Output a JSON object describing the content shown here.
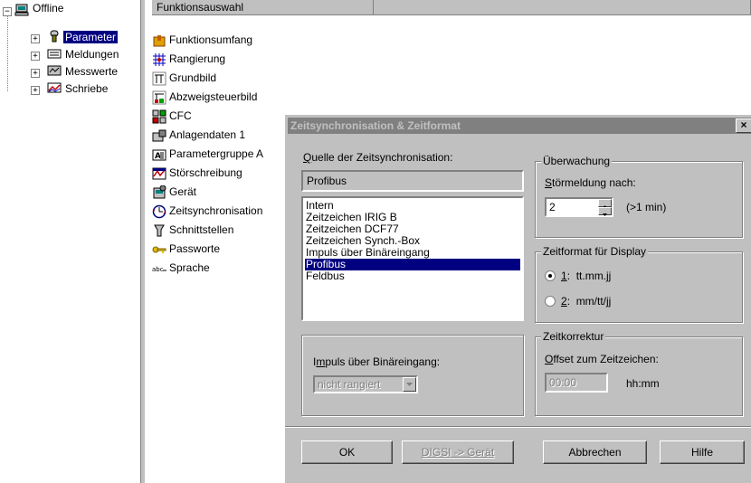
{
  "tree": {
    "root": "Offline",
    "items": [
      {
        "label": "Parameter",
        "selected": true
      },
      {
        "label": "Meldungen"
      },
      {
        "label": "Messwerte"
      },
      {
        "label": "Schriebe"
      }
    ]
  },
  "list": {
    "header": "Funktionsauswahl",
    "items": [
      "Funktionsumfang",
      "Rangierung",
      "Grundbild",
      "Abzweigsteuerbild",
      "CFC",
      "Anlagendaten 1",
      "Parametergruppe A",
      "Störschreibung",
      "Gerät",
      "Zeitsynchronisation",
      "Schnittstellen",
      "Passworte",
      "Sprache"
    ]
  },
  "dialog": {
    "title": "Zeitsynchronisation & Zeitformat",
    "close": "×",
    "source": {
      "label_prefix": "",
      "label_u": "Q",
      "label_rest": "uelle der Zeitsynchronisation:",
      "current": "Profibus",
      "options": [
        "Intern",
        "Zeitzeichen IRIG B",
        "Zeitzeichen DCF77",
        "Zeitzeichen Synch.-Box",
        "Impuls über Binäreingang",
        "Profibus",
        "Feldbus"
      ],
      "selected_index": 5
    },
    "impulse": {
      "label_pre": "I",
      "label_u": "m",
      "label_rest": "puls über Binäreingang:",
      "value": "nicht rangiert"
    },
    "monitor": {
      "legend": "Überwachung",
      "label_u": "S",
      "label_rest": "törmeldung nach:",
      "value": "2",
      "unit": "(>1 min)"
    },
    "format": {
      "legend": "Zeitformat für Display",
      "opt1_u": "1",
      "opt1_rest": ":  tt.mm.jj",
      "opt2_u": "2",
      "opt2_rest": ":  mm/tt/jj",
      "selected": 1
    },
    "correction": {
      "legend": "Zeitkorrektur",
      "label_u": "O",
      "label_rest": "ffset zum Zeitzeichen:",
      "value": "00:00",
      "unit": "hh:mm"
    },
    "buttons": {
      "ok": "OK",
      "digsi": "DIGSI -> Gerät",
      "cancel": "Abbrechen",
      "help": "Hilfe"
    }
  }
}
